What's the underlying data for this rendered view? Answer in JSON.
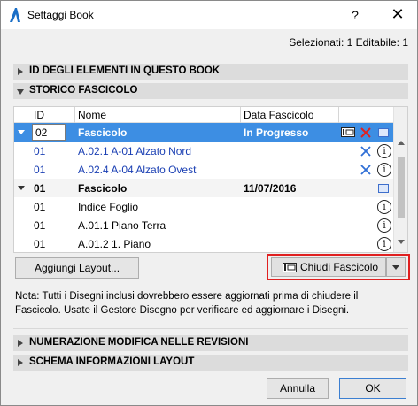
{
  "window": {
    "title": "Settaggi Book",
    "help_label": "?",
    "close_label": "✕"
  },
  "selection_info": "Selezionati: 1 Editabile: 1",
  "sections": {
    "id_elements": "ID DEGLI ELEMENTI IN QUESTO BOOK",
    "history": "STORICO FASCICOLO",
    "revision_numbering": "NUMERAZIONE MODIFICA NELLE REVISIONI",
    "layout_info": "SCHEMA INFORMAZIONI LAYOUT"
  },
  "table": {
    "headers": {
      "id": "ID",
      "name": "Nome",
      "date": "Data Fascicolo"
    },
    "rows": [
      {
        "id": "02",
        "name": "Fascicolo",
        "date": "In Progresso"
      },
      {
        "id": "01",
        "name": "A.02.1 A-01 Alzato Nord",
        "date": ""
      },
      {
        "id": "01",
        "name": "A.02.4 A-04 Alzato Ovest",
        "date": ""
      },
      {
        "id": "01",
        "name": "Fascicolo",
        "date": "11/07/2016"
      },
      {
        "id": "01",
        "name": "Indice Foglio",
        "date": ""
      },
      {
        "id": "01",
        "name": "A.01.1 Piano Terra",
        "date": ""
      },
      {
        "id": "01",
        "name": "A.01.2 1. Piano",
        "date": ""
      }
    ]
  },
  "buttons": {
    "add_layout": "Aggiungi Layout...",
    "close_issue": "Chiudi Fascicolo",
    "cancel": "Annulla",
    "ok": "OK"
  },
  "note": "Nota: Tutti i Disegni inclusi dovrebbero essere aggiornati prima di chiudere il Fascicolo. Usate il Gestore Disegno per verificare ed aggiornare i Disegni.",
  "colors": {
    "selection": "#3d8ee3",
    "link": "#1a3fb3",
    "delete_red": "#e02020",
    "delete_blue": "#2f6fd6",
    "highlight": "#e02020"
  }
}
